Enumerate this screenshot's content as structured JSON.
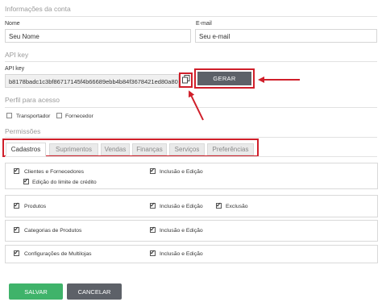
{
  "account": {
    "section_title": "Informações da conta",
    "name_label": "Nome",
    "name_value": "Seu Nome",
    "email_label": "E-mail",
    "email_value": "Seu e-mail"
  },
  "api": {
    "section_title": "API key",
    "key_label": "API key",
    "key_value": "b8178badc1c3bf86717145f4b66689ebb4b84f3678421ed80a800",
    "copy_icon": "copy-icon",
    "generate_label": "GERAR"
  },
  "access": {
    "section_title": "Perfil para acesso",
    "options": [
      {
        "label": "Transportador",
        "checked": false
      },
      {
        "label": "Fornecedor",
        "checked": false
      }
    ]
  },
  "permissions": {
    "section_title": "Permissões",
    "tabs": [
      "Cadastros",
      "Suprimentos",
      "Vendas",
      "Finanças",
      "Serviços",
      "Preferências"
    ],
    "active_tab": "Cadastros",
    "groups": [
      {
        "label": "Clientes e Fornecedores",
        "checked": true,
        "sub_label": "Edição do limite de crédito",
        "sub_checked": true,
        "perm1": "Inclusão e Edição",
        "perm1_checked": true
      },
      {
        "label": "Produtos",
        "checked": true,
        "perm1": "Inclusão e Edição",
        "perm1_checked": true,
        "perm2": "Exclusão",
        "perm2_checked": true
      },
      {
        "label": "Categorias de Produtos",
        "checked": true,
        "perm1": "Inclusão e Edição",
        "perm1_checked": true
      },
      {
        "label": "Configurações de Multilojas",
        "checked": true,
        "perm1": "Inclusão e Edição",
        "perm1_checked": true
      }
    ]
  },
  "actions": {
    "save_label": "SALVAR",
    "cancel_label": "CANCELAR"
  },
  "colors": {
    "highlight": "#d01f2a",
    "save": "#3fb36a",
    "dark_button": "#5d6168"
  }
}
